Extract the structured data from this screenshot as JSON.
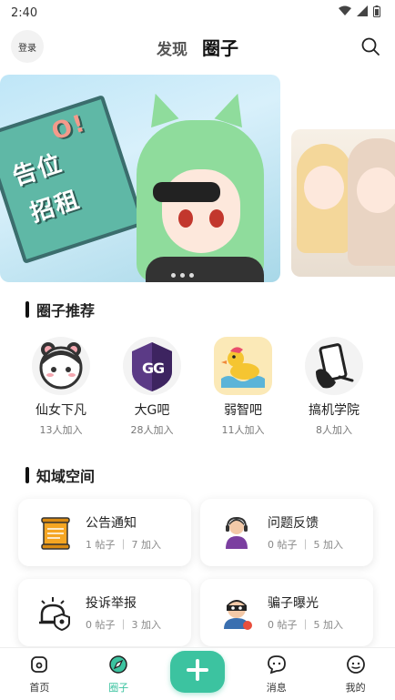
{
  "status_bar": {
    "time": "2:40"
  },
  "header": {
    "login_label": "登录",
    "tabs": [
      {
        "label": "发现"
      },
      {
        "label": "圈子"
      }
    ]
  },
  "banner": {
    "sign_line1": "告位",
    "sign_line2": "招租",
    "sign_ok": "O!"
  },
  "recommend": {
    "title": "圈子推荐",
    "items": [
      {
        "name": "仙女下凡",
        "count": "13人加入"
      },
      {
        "name": "大G吧",
        "count": "28人加入"
      },
      {
        "name": "弱智吧",
        "count": "11人加入"
      },
      {
        "name": "搞机学院",
        "count": "8人加入"
      }
    ]
  },
  "zones": {
    "title": "知域空间",
    "items": [
      {
        "name": "公告通知",
        "meta": "1 帖子 ｜ 7 加入"
      },
      {
        "name": "问题反馈",
        "meta": "0 帖子 ｜ 5 加入"
      },
      {
        "name": "投诉举报",
        "meta": "0 帖子 ｜ 3 加入"
      },
      {
        "name": "骗子曝光",
        "meta": "0 帖子 ｜ 5 加入"
      }
    ]
  },
  "tabbar": {
    "items": [
      {
        "label": "首页"
      },
      {
        "label": "圈子"
      },
      {
        "label": "消息"
      },
      {
        "label": "我的"
      }
    ],
    "active_color": "#3cc3a0"
  },
  "colors": {
    "accent": "#3cc3a0"
  }
}
